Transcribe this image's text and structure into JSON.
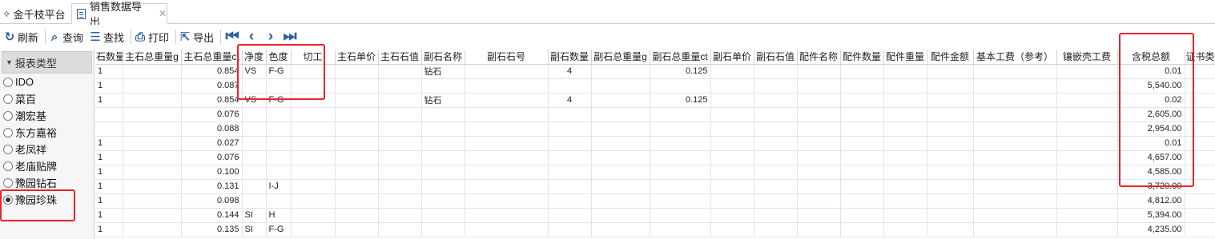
{
  "tabs": {
    "home_label": "金千枝平台",
    "export_label": "销售数据导出",
    "close_glyph": "✕"
  },
  "toolbar": {
    "refresh": "刷新",
    "query": "查询",
    "find": "查找",
    "print": "打印",
    "export": "导出"
  },
  "sidebar": {
    "header": "报表类型",
    "items": [
      {
        "label": "IDO",
        "checked": false
      },
      {
        "label": "菜百",
        "checked": false
      },
      {
        "label": "潮宏基",
        "checked": false
      },
      {
        "label": "东方嘉裕",
        "checked": false
      },
      {
        "label": "老凤祥",
        "checked": false
      },
      {
        "label": "老庙贴牌",
        "checked": false
      },
      {
        "label": "豫园钻石",
        "checked": false
      },
      {
        "label": "豫园珍珠",
        "checked": true
      }
    ]
  },
  "grid": {
    "columns": [
      "石数量",
      "主石总重量g",
      "主石总重量ct",
      "净度",
      "色度",
      "切工",
      "主石单价",
      "主石石值",
      "副石名称",
      "副石石号",
      "副石数量",
      "副石总重量g",
      "副石总重量ct",
      "副石单价",
      "副石石值",
      "配件名称",
      "配件数量",
      "配件重量",
      "配件金额",
      "基本工费（参考）",
      "镶嵌壳工费",
      "含税总额",
      "证书类型"
    ],
    "rows": [
      {
        "c0": "1",
        "c2": "0.854",
        "c3": "VS",
        "c4": "F-G",
        "c8": "钻石",
        "c10": "4",
        "c12": "0.125",
        "c21": "0.01"
      },
      {
        "c0": "1",
        "c2": "0.087",
        "c21": "5,540.00"
      },
      {
        "c0": "1",
        "c2": "0.854",
        "c3": "VS",
        "c4": "F-G",
        "c8": "钻石",
        "c10": "4",
        "c12": "0.125",
        "c21": "0.02"
      },
      {
        "c2": "0.076",
        "c21": "2,605.00"
      },
      {
        "c2": "0.088",
        "c21": "2,954.00"
      },
      {
        "c0": "1",
        "c2": "0.027",
        "c21": "0.01"
      },
      {
        "c0": "1",
        "c2": "0.076",
        "c21": "4,657.00"
      },
      {
        "c0": "1",
        "c2": "0.100",
        "c21": "4,585.00"
      },
      {
        "c0": "1",
        "c2": "0.131",
        "c4": "I-J",
        "c21": "3,720.00"
      },
      {
        "c0": "1",
        "c2": "0.098",
        "c21": "4,812.00"
      },
      {
        "c0": "1",
        "c2": "0.144",
        "c3": "SI",
        "c4": "H",
        "c21": "5,394.00"
      },
      {
        "c0": "1",
        "c2": "0.135",
        "c3": "SI",
        "c4": "F-G",
        "c21": "4,235.00"
      }
    ]
  },
  "annotation_color": "#e8232a"
}
